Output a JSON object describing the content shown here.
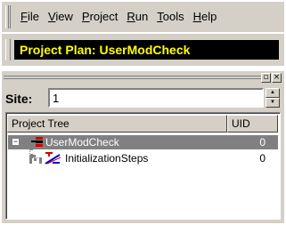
{
  "menu": {
    "items": [
      {
        "mn": "F",
        "rest": "ile"
      },
      {
        "mn": "V",
        "rest": "iew"
      },
      {
        "mn": "P",
        "rest": "roject"
      },
      {
        "mn": "R",
        "rest": "un"
      },
      {
        "mn": "T",
        "rest": "ools"
      },
      {
        "mn": "H",
        "rest": "elp"
      }
    ]
  },
  "plan": {
    "title": "Project Plan: UserModCheck"
  },
  "site": {
    "label": "Site:",
    "value": "1"
  },
  "tree": {
    "columns": {
      "name": "Project Tree",
      "uid": "UID"
    },
    "rows": [
      {
        "label": "UserModCheck",
        "uid": "0",
        "selected": true,
        "icon": "project-node-icon"
      },
      {
        "label": "InitializationSteps",
        "uid": "0",
        "selected": false,
        "icon": "steps-node-icon"
      }
    ],
    "colors": {
      "selection": "#808080",
      "icon_red": "#cc0000",
      "icon_blue": "#0000cc"
    }
  },
  "panel": {
    "pin_glyph": "▫",
    "close_glyph": "×"
  }
}
